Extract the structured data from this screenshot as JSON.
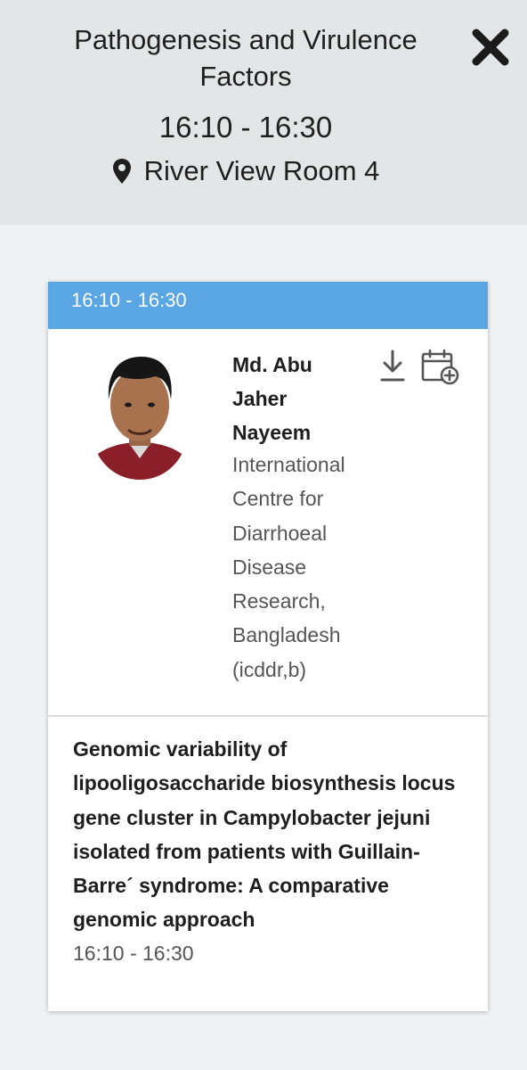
{
  "session": {
    "title": "Pathogenesis and Virulence Factors",
    "time": "16:10 - 16:30",
    "room": "River View Room 4"
  },
  "icons": {
    "close": "close-icon",
    "location": "location-pin-icon",
    "download": "download-icon",
    "calendar_add": "calendar-add-icon"
  },
  "card": {
    "header_time": "16:10 - 16:30",
    "speaker": {
      "name": "Md. Abu Jaher Nayeem",
      "organization": "International Centre for Diarrhoeal Disease Research, Bangladesh (icddr,b)"
    },
    "talk": {
      "title": "Genomic variability of lipooligosaccharide biosynthesis locus gene cluster in Campylobacter jejuni isolated from patients with Guillain-Barre´ syndrome: A comparative genomic approach",
      "time": "16:10 - 16:30"
    }
  },
  "colors": {
    "header_bg": "#e3e6e6",
    "page_bg": "#eef2f3",
    "accent_bar": "#5aa5e3"
  }
}
